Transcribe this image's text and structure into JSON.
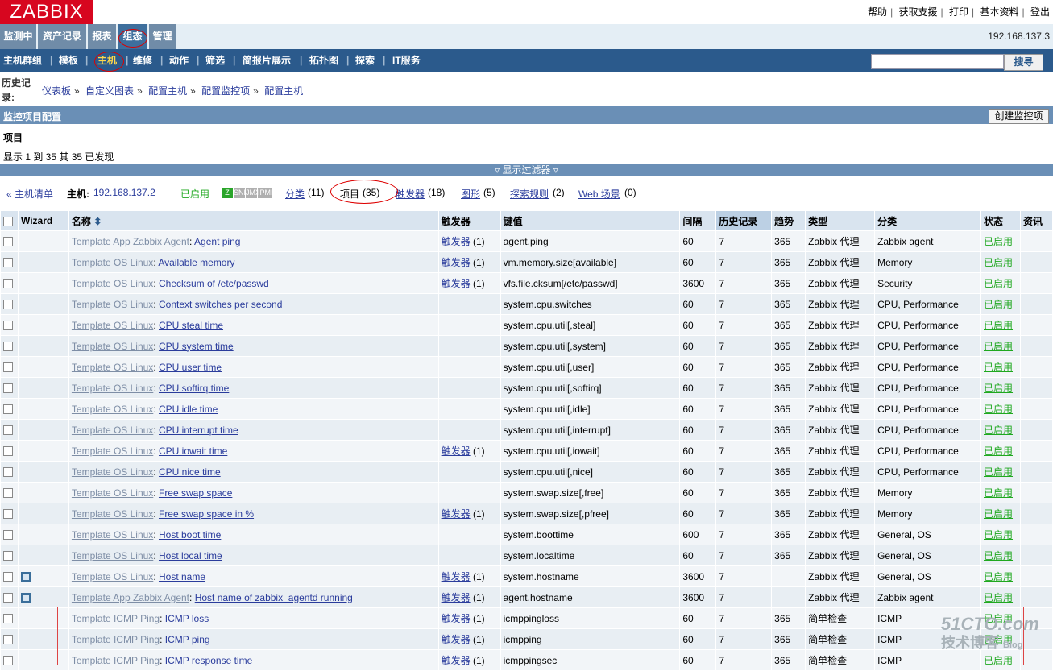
{
  "logo": "ZABBIX",
  "top_links": [
    "帮助",
    "获取支援",
    "打印",
    "基本资料",
    "登出"
  ],
  "main_menu": [
    "监测中",
    "资产记录",
    "报表",
    "组态",
    "管理"
  ],
  "server_ip": "192.168.137.3",
  "sub_menu": [
    "主机群组",
    "模板",
    "主机",
    "维修",
    "动作",
    "筛选",
    "简报片展示",
    "拓扑图",
    "探索",
    "IT服务"
  ],
  "search": {
    "value": "",
    "button": "搜寻"
  },
  "history_label": "历史记录:",
  "breadcrumbs": [
    "仪表板",
    "自定义图表",
    "配置主机",
    "配置监控项",
    "配置主机"
  ],
  "page_band_title": "监控项目配置",
  "create_button": "创建监控项",
  "section_title": "项目",
  "showing": "显示 1 到 35 其 35 已发现",
  "filter_toggle": "▿ 显示过滤器 ▿",
  "host_bar": {
    "back": "« 主机清单",
    "host_label": "主机:",
    "host_ip": "192.168.137.2",
    "status": "已启用",
    "avail": [
      "Z",
      "SNMP",
      "JMX",
      "IPMI"
    ],
    "app_link": "分类",
    "app_count": "(11)",
    "items_label": "项目",
    "items_count": "(35)",
    "triggers_link": "触发器",
    "triggers_count": "(18)",
    "graphs_link": "图形",
    "graphs_count": "(5)",
    "discovery_link": "探索规则",
    "discovery_count": "(2)",
    "web_link": "Web 场景",
    "web_count": "(0)"
  },
  "table": {
    "headers": [
      "",
      "Wizard",
      "名称",
      "触发器",
      "键值",
      "间隔",
      "历史记录",
      "趋势",
      "类型",
      "分类",
      "状态",
      "资讯"
    ],
    "rows": [
      {
        "tpl": "Template App Zabbix Agent",
        "name": "Agent ping",
        "trig": "触发器",
        "tc": "(1)",
        "key": "agent.ping",
        "intv": "60",
        "hist": "7",
        "trend": "365",
        "type": "Zabbix 代理",
        "app": "Zabbix agent",
        "status": "已启用",
        "wizard": false
      },
      {
        "tpl": "Template OS Linux",
        "name": "Available memory",
        "trig": "触发器",
        "tc": "(1)",
        "key": "vm.memory.size[available]",
        "intv": "60",
        "hist": "7",
        "trend": "365",
        "type": "Zabbix 代理",
        "app": "Memory",
        "status": "已启用",
        "wizard": false
      },
      {
        "tpl": "Template OS Linux",
        "name": "Checksum of /etc/passwd",
        "trig": "触发器",
        "tc": "(1)",
        "key": "vfs.file.cksum[/etc/passwd]",
        "intv": "3600",
        "hist": "7",
        "trend": "365",
        "type": "Zabbix 代理",
        "app": "Security",
        "status": "已启用",
        "wizard": false
      },
      {
        "tpl": "Template OS Linux",
        "name": "Context switches per second",
        "trig": "",
        "tc": "",
        "key": "system.cpu.switches",
        "intv": "60",
        "hist": "7",
        "trend": "365",
        "type": "Zabbix 代理",
        "app": "CPU, Performance",
        "status": "已启用",
        "wizard": false
      },
      {
        "tpl": "Template OS Linux",
        "name": "CPU steal time",
        "trig": "",
        "tc": "",
        "key": "system.cpu.util[,steal]",
        "intv": "60",
        "hist": "7",
        "trend": "365",
        "type": "Zabbix 代理",
        "app": "CPU, Performance",
        "status": "已启用",
        "wizard": false
      },
      {
        "tpl": "Template OS Linux",
        "name": "CPU system time",
        "trig": "",
        "tc": "",
        "key": "system.cpu.util[,system]",
        "intv": "60",
        "hist": "7",
        "trend": "365",
        "type": "Zabbix 代理",
        "app": "CPU, Performance",
        "status": "已启用",
        "wizard": false
      },
      {
        "tpl": "Template OS Linux",
        "name": "CPU user time",
        "trig": "",
        "tc": "",
        "key": "system.cpu.util[,user]",
        "intv": "60",
        "hist": "7",
        "trend": "365",
        "type": "Zabbix 代理",
        "app": "CPU, Performance",
        "status": "已启用",
        "wizard": false
      },
      {
        "tpl": "Template OS Linux",
        "name": "CPU softirq time",
        "trig": "",
        "tc": "",
        "key": "system.cpu.util[,softirq]",
        "intv": "60",
        "hist": "7",
        "trend": "365",
        "type": "Zabbix 代理",
        "app": "CPU, Performance",
        "status": "已启用",
        "wizard": false
      },
      {
        "tpl": "Template OS Linux",
        "name": "CPU idle time",
        "trig": "",
        "tc": "",
        "key": "system.cpu.util[,idle]",
        "intv": "60",
        "hist": "7",
        "trend": "365",
        "type": "Zabbix 代理",
        "app": "CPU, Performance",
        "status": "已启用",
        "wizard": false
      },
      {
        "tpl": "Template OS Linux",
        "name": "CPU interrupt time",
        "trig": "",
        "tc": "",
        "key": "system.cpu.util[,interrupt]",
        "intv": "60",
        "hist": "7",
        "trend": "365",
        "type": "Zabbix 代理",
        "app": "CPU, Performance",
        "status": "已启用",
        "wizard": false
      },
      {
        "tpl": "Template OS Linux",
        "name": "CPU iowait time",
        "trig": "触发器",
        "tc": "(1)",
        "key": "system.cpu.util[,iowait]",
        "intv": "60",
        "hist": "7",
        "trend": "365",
        "type": "Zabbix 代理",
        "app": "CPU, Performance",
        "status": "已启用",
        "wizard": false
      },
      {
        "tpl": "Template OS Linux",
        "name": "CPU nice time",
        "trig": "",
        "tc": "",
        "key": "system.cpu.util[,nice]",
        "intv": "60",
        "hist": "7",
        "trend": "365",
        "type": "Zabbix 代理",
        "app": "CPU, Performance",
        "status": "已启用",
        "wizard": false
      },
      {
        "tpl": "Template OS Linux",
        "name": "Free swap space",
        "trig": "",
        "tc": "",
        "key": "system.swap.size[,free]",
        "intv": "60",
        "hist": "7",
        "trend": "365",
        "type": "Zabbix 代理",
        "app": "Memory",
        "status": "已启用",
        "wizard": false
      },
      {
        "tpl": "Template OS Linux",
        "name": "Free swap space in %",
        "trig": "触发器",
        "tc": "(1)",
        "key": "system.swap.size[,pfree]",
        "intv": "60",
        "hist": "7",
        "trend": "365",
        "type": "Zabbix 代理",
        "app": "Memory",
        "status": "已启用",
        "wizard": false
      },
      {
        "tpl": "Template OS Linux",
        "name": "Host boot time",
        "trig": "",
        "tc": "",
        "key": "system.boottime",
        "intv": "600",
        "hist": "7",
        "trend": "365",
        "type": "Zabbix 代理",
        "app": "General, OS",
        "status": "已启用",
        "wizard": false
      },
      {
        "tpl": "Template OS Linux",
        "name": "Host local time",
        "trig": "",
        "tc": "",
        "key": "system.localtime",
        "intv": "60",
        "hist": "7",
        "trend": "365",
        "type": "Zabbix 代理",
        "app": "General, OS",
        "status": "已启用",
        "wizard": false
      },
      {
        "tpl": "Template OS Linux",
        "name": "Host name",
        "trig": "触发器",
        "tc": "(1)",
        "key": "system.hostname",
        "intv": "3600",
        "hist": "7",
        "trend": "",
        "type": "Zabbix 代理",
        "app": "General, OS",
        "status": "已启用",
        "wizard": true
      },
      {
        "tpl": "Template App Zabbix Agent",
        "name": "Host name of zabbix_agentd running",
        "trig": "触发器",
        "tc": "(1)",
        "key": "agent.hostname",
        "intv": "3600",
        "hist": "7",
        "trend": "",
        "type": "Zabbix 代理",
        "app": "Zabbix agent",
        "status": "已启用",
        "wizard": true
      },
      {
        "tpl": "Template ICMP Ping",
        "name": "ICMP loss",
        "trig": "触发器",
        "tc": "(1)",
        "key": "icmppingloss",
        "intv": "60",
        "hist": "7",
        "trend": "365",
        "type": "简单检查",
        "app": "ICMP",
        "status": "已启用",
        "wizard": false
      },
      {
        "tpl": "Template ICMP Ping",
        "name": "ICMP ping",
        "trig": "触发器",
        "tc": "(1)",
        "key": "icmpping",
        "intv": "60",
        "hist": "7",
        "trend": "365",
        "type": "简单检查",
        "app": "ICMP",
        "status": "已启用",
        "wizard": false
      },
      {
        "tpl": "Template ICMP Ping",
        "name": "ICMP response time",
        "trig": "触发器",
        "tc": "(1)",
        "key": "icmppingsec",
        "intv": "60",
        "hist": "7",
        "trend": "365",
        "type": "简单检查",
        "app": "ICMP",
        "status": "已启用",
        "wizard": false
      }
    ]
  },
  "watermark": {
    "line1": "51CTO.com",
    "line2": "技术博客",
    "line3": "Blog"
  }
}
